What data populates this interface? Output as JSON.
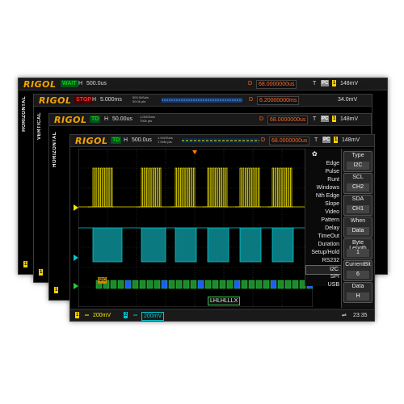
{
  "brand": "RIGOL",
  "screens": [
    {
      "status": "WAIT",
      "timebase_label": "H",
      "timebase": "500.0us",
      "delay_label": "D",
      "delay": "68.0000000us",
      "trig_label": "T",
      "coupling": "PC",
      "trig_level": "148mV",
      "side_label": "HORIZONTAL",
      "ch_badge": "1"
    },
    {
      "status": "STOP",
      "timebase_label": "H",
      "timebase": "5.000ms",
      "sample_rate": "500.0kSa/s",
      "mem_depth": "50.0k pts",
      "delay_label": "D",
      "delay": "6.20000000ms",
      "trig_level": "34.0mV",
      "side_label": "VERTICAL",
      "ch_badge": "1"
    },
    {
      "status": "TD",
      "timebase_label": "H",
      "timebase": "50.00us",
      "sample_rate": "1.00GSa/s",
      "mem_depth": "700k pts",
      "delay_label": "D",
      "delay": "68.0000000us",
      "trig_label": "T",
      "coupling": "PC",
      "trig_level": "148mV",
      "side_label": "HORIZONTAL",
      "ch_badge": "1"
    },
    {
      "status": "TD",
      "timebase_label": "H",
      "timebase": "500.0us",
      "sample_rate": "1.00GSa/s",
      "mem_depth": "7.00M pts",
      "delay_label": "D",
      "delay": "68.0000000us",
      "trig_label": "T",
      "coupling": "PC",
      "trig_level": "148mV",
      "side_label": "HORIZONTAL",
      "ch_badge": "1"
    }
  ],
  "front": {
    "trigger_menu": [
      "Edge",
      "Pulse",
      "Runt",
      "Windows",
      "Nth Edge",
      "Slope",
      "Video",
      "Pattern",
      "Delay",
      "TimeOut",
      "Duration",
      "Setup/Hold",
      "RS232",
      "I2C",
      "SPI",
      "USB"
    ],
    "selected_trigger": "I2C",
    "right_menu": [
      {
        "title": "Type",
        "value": "I2C"
      },
      {
        "title": "SCL",
        "value": "CH2"
      },
      {
        "title": "SDA",
        "value": "CH1"
      },
      {
        "title": "When",
        "value": "Data"
      },
      {
        "title": "Byte Length",
        "value": "1"
      },
      {
        "title": "CurrentBit",
        "value": "6"
      },
      {
        "title": "Data",
        "value": "H"
      }
    ],
    "decode_label": "I2C",
    "decode_marker": "LHLHLLLX",
    "ch1_label": "1",
    "ch1_scale": "200mV",
    "ch2_label": "2",
    "ch2_scale": "200mV",
    "time": "23:35",
    "colors": {
      "ch1": "#f2e600",
      "ch2": "#00c8d2",
      "decode": "#2ecc40",
      "brand": "#f5a400",
      "status_wait": "#1ecb00",
      "status_stop": "#e02020"
    }
  }
}
